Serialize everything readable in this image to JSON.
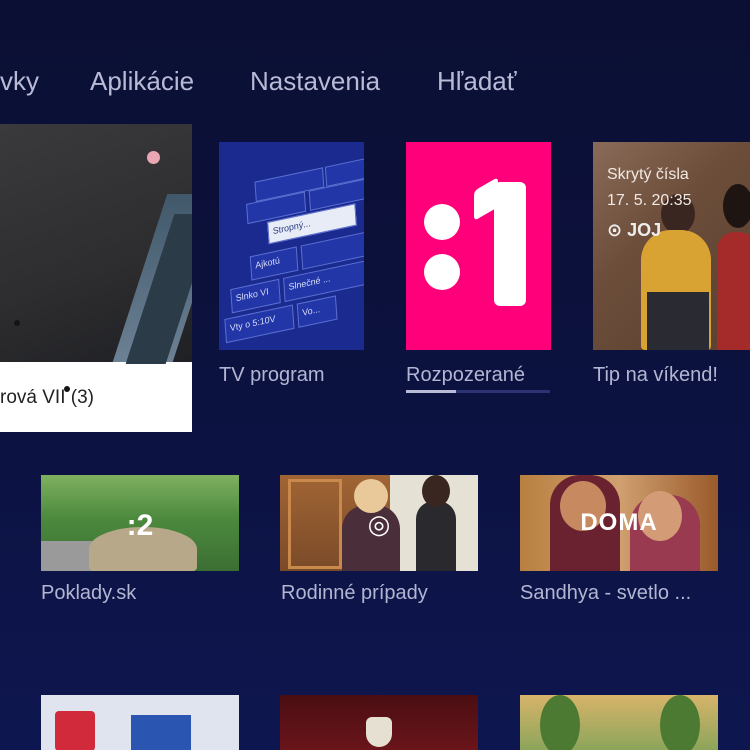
{
  "nav": {
    "items": [
      {
        "label": "vky"
      },
      {
        "label": "Aplikácie"
      },
      {
        "label": "Nastavenia"
      },
      {
        "label": "Hľadať"
      }
    ]
  },
  "row1": {
    "focused": {
      "title": "rová VII (3)"
    },
    "cards": [
      {
        "label": "TV program"
      },
      {
        "label": "Rozpozerané",
        "progress_percent": 35
      },
      {
        "label": "Tip na víkend!"
      }
    ],
    "tv_program_grid": [
      "Stropný...",
      "Ajkotú",
      "Slnko VI",
      "Vty o 5:10V",
      "Slnečné ...",
      "Vo..."
    ],
    "tip": {
      "line1": "Skrytý čísla",
      "line2": "17. 5. 20:35",
      "brand": "JOJ"
    }
  },
  "row2": {
    "cards": [
      {
        "label": "Poklady.sk",
        "logo": ":2"
      },
      {
        "label": "Rodinné prípady",
        "logo": "◎"
      },
      {
        "label": "Sandhya - svetlo ...",
        "logo": "DOMA"
      }
    ]
  },
  "colors": {
    "background": "#0b0f33",
    "accent_pink": "#ff007a",
    "text": "#b3b6d2"
  }
}
